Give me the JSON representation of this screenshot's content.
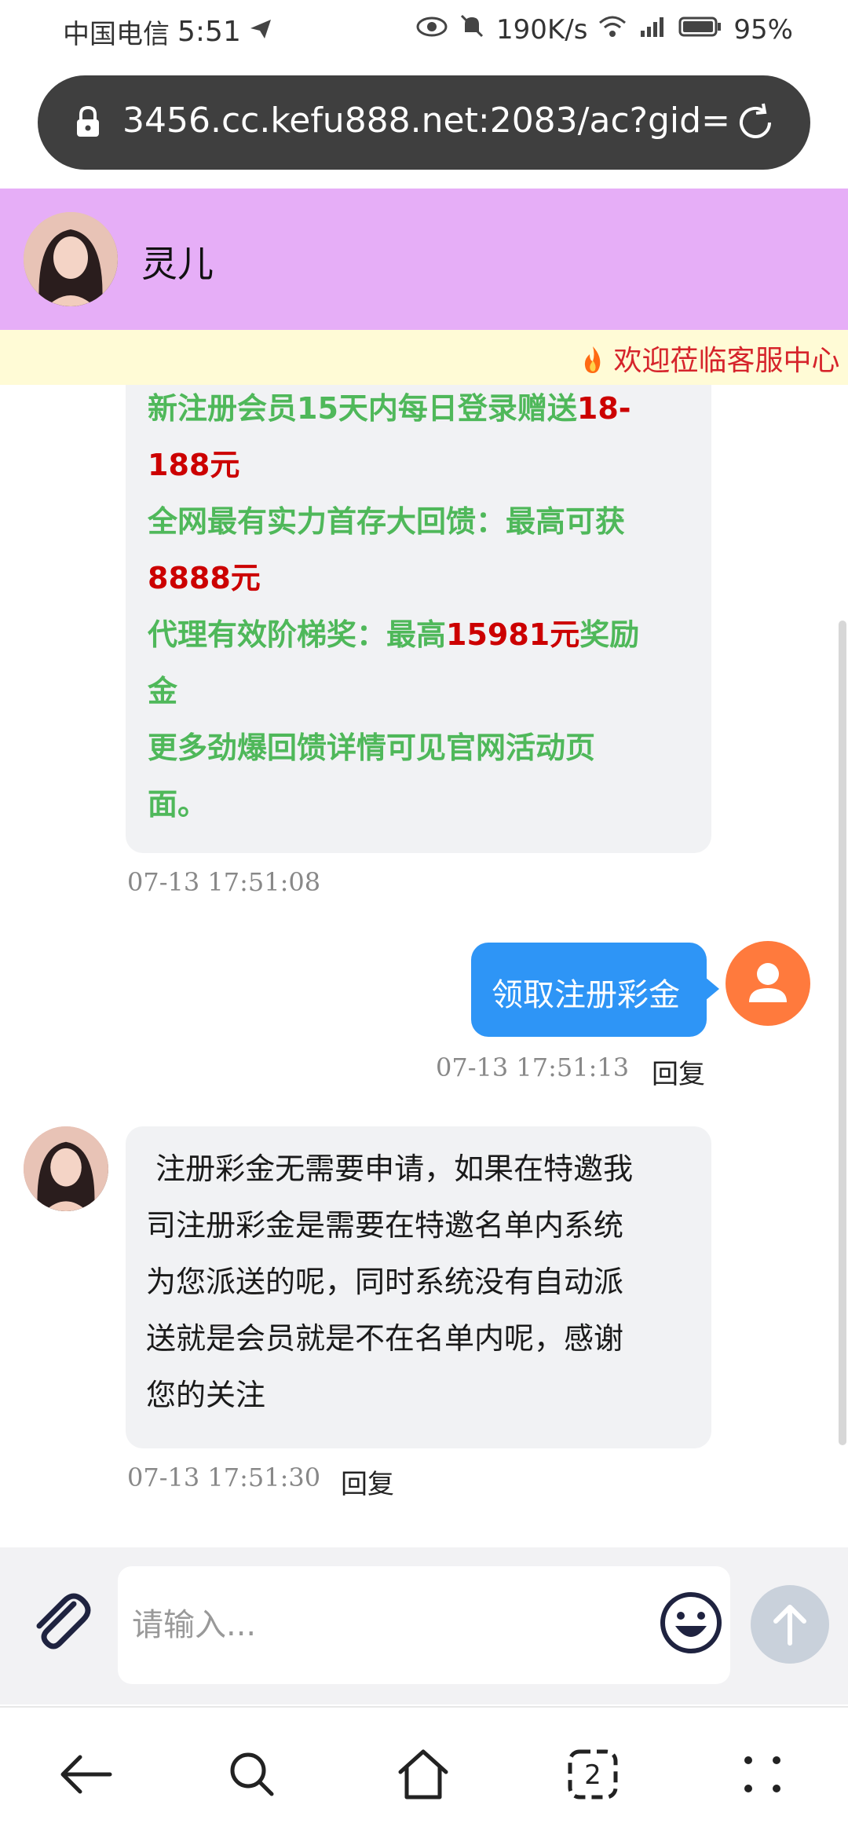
{
  "status_bar": {
    "carrier": "中国电信",
    "time": "5:51",
    "speed": "190K/s",
    "battery": "95%"
  },
  "browser": {
    "url": "3456.cc.kefu888.net:2083/ac?gid="
  },
  "header": {
    "agent_name": "灵儿"
  },
  "marquee": {
    "text": "欢迎莅临客服中心"
  },
  "messages": {
    "promo": {
      "line1_green": "新注册会员15天内每日登录赠送",
      "line1_red": "18-",
      "line2_red": "188元",
      "line3_green": "全网最有实力首存大回馈：最高可获",
      "line4_red": "8888元",
      "line5_green_a": "代理有效阶梯奖：最高",
      "line5_red": "15981元",
      "line5_green_b": "奖励",
      "line6_green": "金",
      "line7_green": "更多劲爆回馈详情可见官网活动页",
      "line8_green": "面。",
      "timestamp": "07-13 17:51:08"
    },
    "user_msg": {
      "text": "领取注册彩金",
      "timestamp": "07-13 17:51:13",
      "reply": "回复"
    },
    "agent_reply": {
      "line1": " 注册彩金无需要申请，如果在特邀我",
      "line2": "司注册彩金是需要在特邀名单内系统",
      "line3": "为您派送的呢，同时系统没有自动派",
      "line4": "送就是会员就是不在名单内呢，感谢",
      "line5": "您的关注",
      "timestamp": "07-13 17:51:30",
      "reply": "回复"
    }
  },
  "input": {
    "placeholder": "请输入..."
  },
  "colors": {
    "header_bg": "#e6aef7",
    "user_bubble": "#2e95f6",
    "user_avatar": "#ff7a3d",
    "promo_green": "#4fb85a",
    "promo_red": "#cc0000"
  }
}
